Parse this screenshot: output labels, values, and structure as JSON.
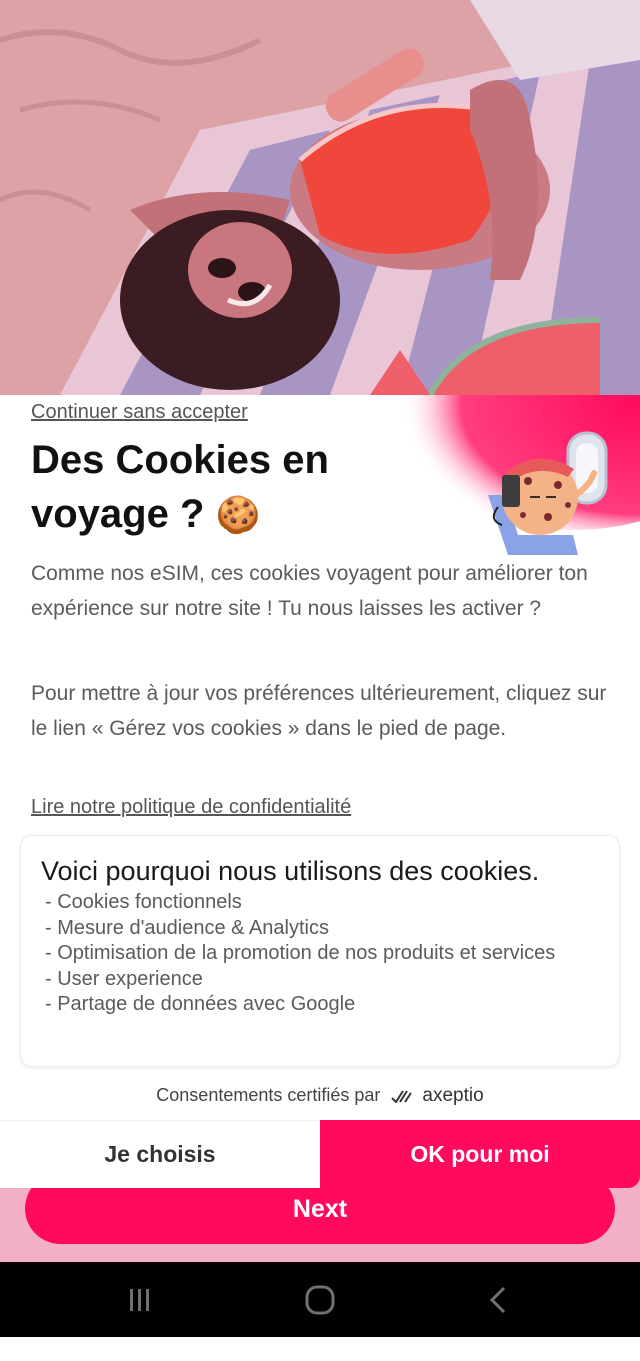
{
  "hero": {
    "scene": "photo"
  },
  "consent": {
    "skip_link": "Continuer sans accepter",
    "title_line1": "Des Cookies en",
    "title_line2": "voyage ?",
    "title_emoji": "🍪",
    "paragraph1": "Comme nos eSIM, ces cookies voyagent pour améliorer ton expérience sur notre site ! Tu nous laisses les activer ?",
    "paragraph2": "Pour mettre à jour vos préférences ultérieurement, cliquez sur le lien « Gérez vos cookies » dans le pied de page.",
    "privacy_link": "Lire notre politique de confidentialité",
    "purposes_title": "Voici pourquoi nous utilisons des cookies.",
    "purposes": [
      "Cookies fonctionnels",
      "Mesure d'audience & Analytics",
      "Optimisation de la promotion de nos produits et services",
      "User experience",
      "Partage de données avec Google"
    ],
    "certified_text": "Consentements certifiés par",
    "certified_brand": "axeptio",
    "choose_button": "Je choisis",
    "accept_button": "OK pour moi",
    "mascot_icon": "cookie-traveler-icon",
    "brand_icon": "axeptio-logo-icon"
  },
  "app": {
    "next_button": "Next"
  },
  "navbar": {
    "recents_icon": "recents-icon",
    "home_icon": "home-icon",
    "back_icon": "back-icon"
  },
  "colors": {
    "accent": "#ff0a5e",
    "text_dark": "#111111",
    "text_muted": "#5b5b5b",
    "page_background": "#f2b0c6"
  }
}
